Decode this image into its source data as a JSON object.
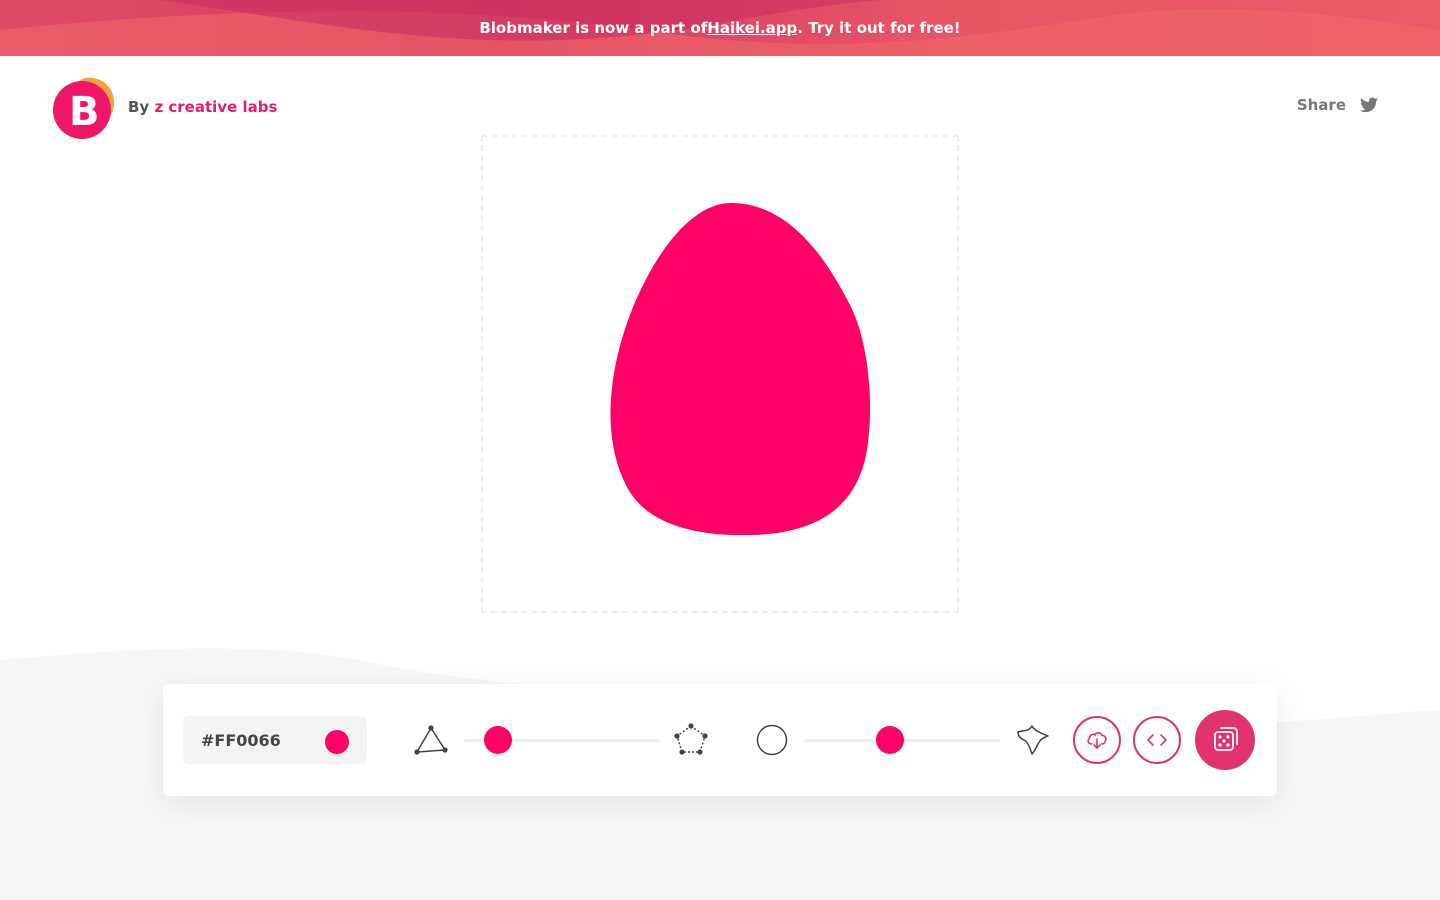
{
  "banner": {
    "text_before": "Blobmaker is now a part of ",
    "link_text": "Haikei.app",
    "text_after": ". Try it out for free!"
  },
  "header": {
    "logo_letter": "B",
    "by_prefix": "By ",
    "brand": "z creative labs",
    "share_label": "Share",
    "share_icon": "twitter-icon"
  },
  "blob": {
    "color": "#FF0066"
  },
  "controls": {
    "color_value": "#FF0066",
    "complexity_slider": {
      "min_icon": "triangle-nodes-icon",
      "max_icon": "pentagon-nodes-icon",
      "value": 0.12
    },
    "contrast_slider": {
      "min_icon": "circle-outline-icon",
      "max_icon": "spiky-blob-icon",
      "value": 0.43
    },
    "download_icon": "cloud-download-icon",
    "code_icon": "code-brackets-icon",
    "random_icon": "dice-icon"
  },
  "colors": {
    "accent": "#ff0066",
    "brand_pink": "#e21f6c",
    "banner_start": "#e04b66",
    "banner_end": "#ea5a67",
    "logo_orange": "#f6a03c"
  }
}
